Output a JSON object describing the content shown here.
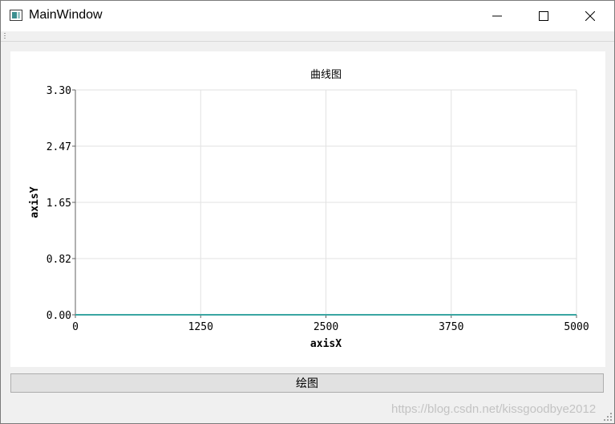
{
  "window": {
    "title": "MainWindow",
    "icon": "app-window-icon"
  },
  "controls": {
    "minimize_icon": "minimize-icon",
    "maximize_icon": "maximize-icon",
    "close_icon": "close-icon"
  },
  "chart_data": {
    "type": "line",
    "title": "曲线图",
    "xlabel": "axisX",
    "ylabel": "axisY",
    "xlim": [
      0,
      5000
    ],
    "ylim": [
      0.0,
      3.3
    ],
    "x_ticks": [
      "0",
      "1250",
      "2500",
      "3750",
      "5000"
    ],
    "y_ticks": [
      "0.00",
      "0.82",
      "1.65",
      "2.47",
      "3.30"
    ],
    "grid": true,
    "series": [
      {
        "color": "#3aa6a2",
        "x": [
          0,
          5000
        ],
        "y": [
          0,
          0
        ]
      }
    ]
  },
  "draw_button": {
    "label": "绘图"
  },
  "watermark": "https://blog.csdn.net/kissgoodbye2012",
  "colors": {
    "series": "#3aa6a2",
    "grid": "#e2e2e2",
    "axis": "#606060"
  }
}
